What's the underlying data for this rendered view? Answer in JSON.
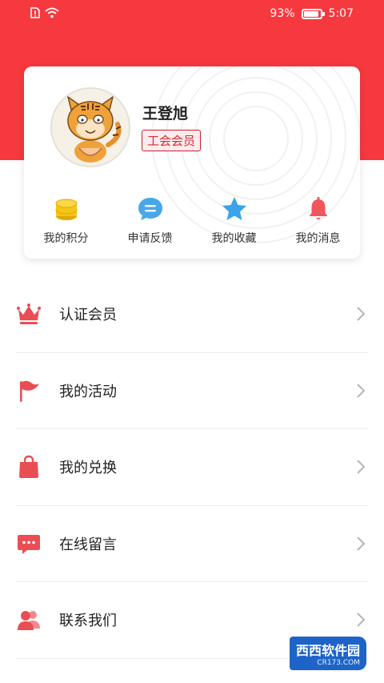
{
  "status_bar": {
    "battery": "93%",
    "time": "5:07",
    "battery_level": 0.93
  },
  "profile": {
    "name": "王登旭",
    "badge": "工会会员"
  },
  "quick_actions": [
    {
      "label": "我的积分",
      "icon": "coin-stack-icon"
    },
    {
      "label": "申请反馈",
      "icon": "chat-bubble-icon"
    },
    {
      "label": "我的收藏",
      "icon": "star-icon"
    },
    {
      "label": "我的消息",
      "icon": "bell-icon"
    }
  ],
  "menu": [
    {
      "label": "认证会员",
      "icon": "crown-icon"
    },
    {
      "label": "我的活动",
      "icon": "flag-icon"
    },
    {
      "label": "我的兑换",
      "icon": "shopping-bag-icon"
    },
    {
      "label": "在线留言",
      "icon": "message-icon"
    },
    {
      "label": "联系我们",
      "icon": "contacts-icon"
    }
  ],
  "watermark": {
    "title": "西西软件园",
    "subtitle": "CR173.COM"
  },
  "colors": {
    "header_red": "#f6393f",
    "icon_red": "#e94e54",
    "coin_yellow": "#f5c518",
    "chat_blue": "#47a8e8",
    "star_blue": "#3aa3ea",
    "bell_red": "#f2555b"
  }
}
